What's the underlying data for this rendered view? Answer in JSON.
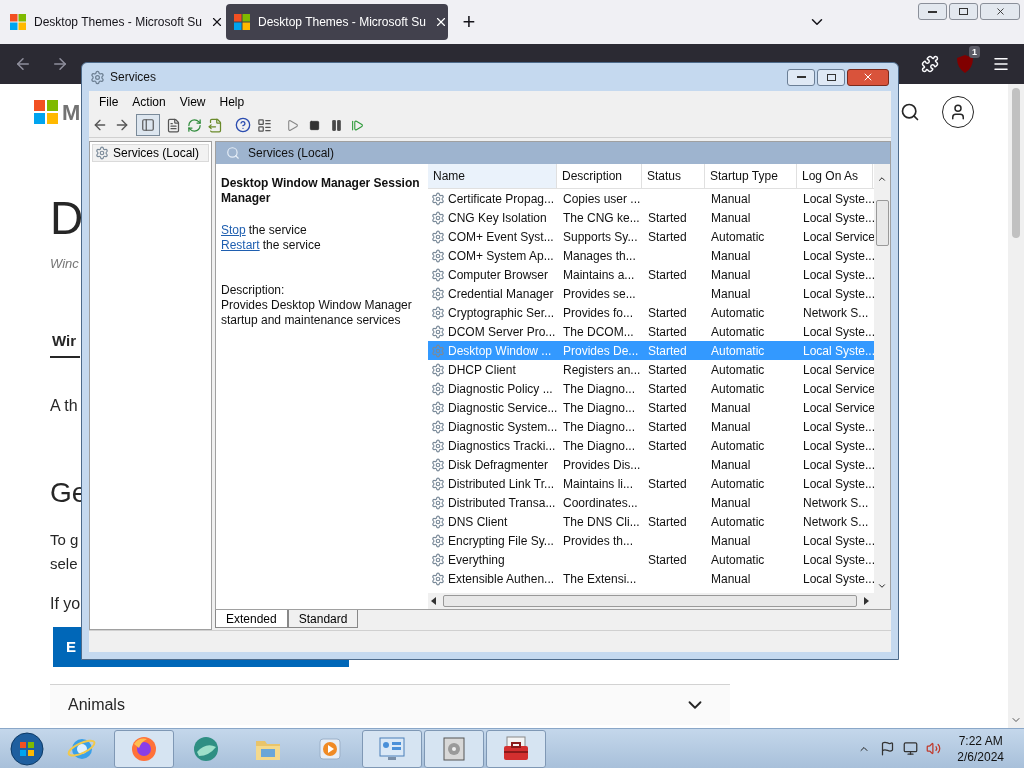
{
  "browser": {
    "tabs": [
      {
        "title": "Desktop Themes - Microsoft Su",
        "selected": false
      },
      {
        "title": "Desktop Themes - Microsoft Su",
        "selected": true
      }
    ],
    "new_tab": "+",
    "extension_badge": "1"
  },
  "page": {
    "logo_letter": "M",
    "heading": "D",
    "subtitle": "Winc",
    "tab_label": "Wir",
    "para1": "A th",
    "heading2": "Ge",
    "para2": [
      "To g",
      "sele"
    ],
    "para3": "If yo",
    "button": "E",
    "accordion": "Animals"
  },
  "window": {
    "title": "Services",
    "menu": [
      "File",
      "Action",
      "View",
      "Help"
    ],
    "tree_item": "Services (Local)",
    "header": "Services (Local)",
    "detail": {
      "title": "Desktop Window Manager Session Manager",
      "actions": [
        {
          "link": "Stop",
          "rest": "the service"
        },
        {
          "link": "Restart",
          "rest": "the service"
        }
      ],
      "description_label": "Description:",
      "description": "Provides Desktop Window Manager startup and maintenance services"
    },
    "table": {
      "columns": [
        "Name",
        "Description",
        "Status",
        "Startup Type",
        "Log On As"
      ],
      "rows": [
        {
          "name": "Certificate Propag...",
          "description": "Copies user ...",
          "status": "",
          "startup": "Manual",
          "logon": "Local Syste...",
          "selected": false
        },
        {
          "name": "CNG Key Isolation",
          "description": "The CNG ke...",
          "status": "Started",
          "startup": "Manual",
          "logon": "Local Syste...",
          "selected": false
        },
        {
          "name": "COM+ Event Syst...",
          "description": "Supports Sy...",
          "status": "Started",
          "startup": "Automatic",
          "logon": "Local Service",
          "selected": false
        },
        {
          "name": "COM+ System Ap...",
          "description": "Manages th...",
          "status": "",
          "startup": "Manual",
          "logon": "Local Syste...",
          "selected": false
        },
        {
          "name": "Computer Browser",
          "description": "Maintains a...",
          "status": "Started",
          "startup": "Manual",
          "logon": "Local Syste...",
          "selected": false
        },
        {
          "name": "Credential Manager",
          "description": "Provides se...",
          "status": "",
          "startup": "Manual",
          "logon": "Local Syste...",
          "selected": false
        },
        {
          "name": "Cryptographic Ser...",
          "description": "Provides fo...",
          "status": "Started",
          "startup": "Automatic",
          "logon": "Network S...",
          "selected": false
        },
        {
          "name": "DCOM Server Pro...",
          "description": "The DCOM...",
          "status": "Started",
          "startup": "Automatic",
          "logon": "Local Syste...",
          "selected": false
        },
        {
          "name": "Desktop Window ...",
          "description": "Provides De...",
          "status": "Started",
          "startup": "Automatic",
          "logon": "Local Syste...",
          "selected": true
        },
        {
          "name": "DHCP Client",
          "description": "Registers an...",
          "status": "Started",
          "startup": "Automatic",
          "logon": "Local Service",
          "selected": false
        },
        {
          "name": "Diagnostic Policy ...",
          "description": "The Diagno...",
          "status": "Started",
          "startup": "Automatic",
          "logon": "Local Service",
          "selected": false
        },
        {
          "name": "Diagnostic Service...",
          "description": "The Diagno...",
          "status": "Started",
          "startup": "Manual",
          "logon": "Local Service",
          "selected": false
        },
        {
          "name": "Diagnostic System...",
          "description": "The Diagno...",
          "status": "Started",
          "startup": "Manual",
          "logon": "Local Syste...",
          "selected": false
        },
        {
          "name": "Diagnostics Tracki...",
          "description": "The Diagno...",
          "status": "Started",
          "startup": "Automatic",
          "logon": "Local Syste...",
          "selected": false
        },
        {
          "name": "Disk Defragmenter",
          "description": "Provides Dis...",
          "status": "",
          "startup": "Manual",
          "logon": "Local Syste...",
          "selected": false
        },
        {
          "name": "Distributed Link Tr...",
          "description": "Maintains li...",
          "status": "Started",
          "startup": "Automatic",
          "logon": "Local Syste...",
          "selected": false
        },
        {
          "name": "Distributed Transa...",
          "description": "Coordinates...",
          "status": "",
          "startup": "Manual",
          "logon": "Network S...",
          "selected": false
        },
        {
          "name": "DNS Client",
          "description": "The DNS Cli...",
          "status": "Started",
          "startup": "Automatic",
          "logon": "Network S...",
          "selected": false
        },
        {
          "name": "Encrypting File Sy...",
          "description": "Provides th...",
          "status": "",
          "startup": "Manual",
          "logon": "Local Syste...",
          "selected": false
        },
        {
          "name": "Everything",
          "description": "",
          "status": "Started",
          "startup": "Automatic",
          "logon": "Local Syste...",
          "selected": false
        },
        {
          "name": "Extensible Authen...",
          "description": "The Extensi...",
          "status": "",
          "startup": "Manual",
          "logon": "Local Syste...",
          "selected": false
        }
      ]
    },
    "view_tabs": [
      {
        "label": "Extended",
        "selected": true
      },
      {
        "label": "Standard",
        "selected": false
      }
    ]
  },
  "taskbar": {
    "apps": [
      {
        "kind": "ie",
        "running": false
      },
      {
        "kind": "firefox",
        "running": true
      },
      {
        "kind": "globe",
        "running": false
      },
      {
        "kind": "folder",
        "running": false
      },
      {
        "kind": "media",
        "running": false
      },
      {
        "kind": "control",
        "running": true
      },
      {
        "kind": "disk",
        "running": true
      },
      {
        "kind": "toolbox",
        "running": true
      }
    ],
    "time": "7:22 AM",
    "date": "2/6/2024"
  }
}
